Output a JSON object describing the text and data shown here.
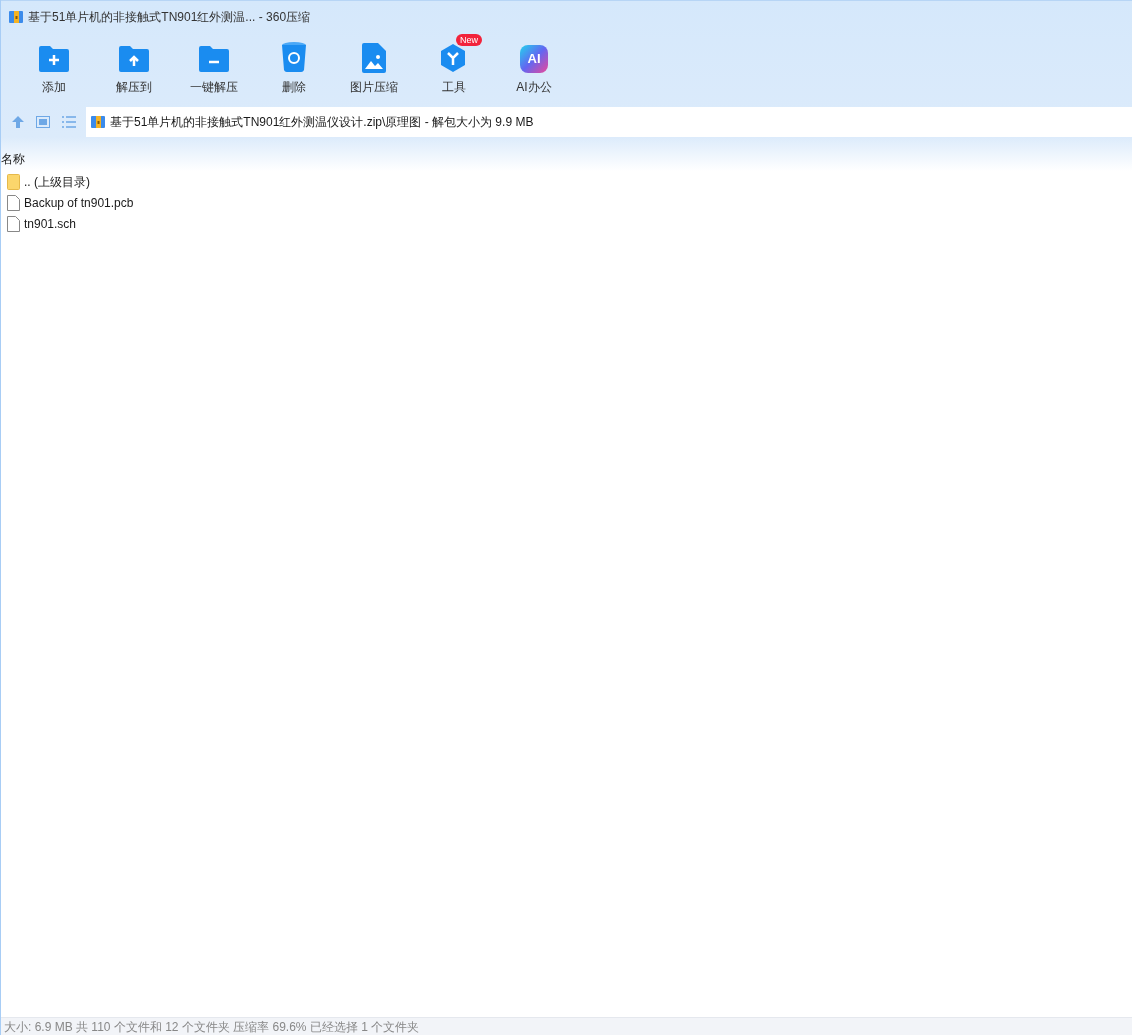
{
  "window": {
    "title": "基于51单片机的非接触式TN901红外测温... - 360压缩"
  },
  "toolbar": [
    {
      "kind": "add",
      "label": "添加"
    },
    {
      "kind": "extract",
      "label": "解压到"
    },
    {
      "kind": "quick",
      "label": "一键解压"
    },
    {
      "kind": "delete",
      "label": "删除"
    },
    {
      "kind": "image",
      "label": "图片压缩"
    },
    {
      "kind": "tools",
      "label": "工具",
      "badge": "New"
    },
    {
      "kind": "ai",
      "label": "AI办公",
      "glyph": "AI"
    }
  ],
  "address": {
    "path": "基于51单片机的非接触式TN901红外测温仪设计.zip\\原理图 - 解包大小为 9.9 MB"
  },
  "table": {
    "columns": [
      "名称"
    ],
    "rows": [
      {
        "kind": "folder",
        "name": ".. (上级目录)"
      },
      {
        "kind": "file",
        "name": "Backup of tn901.pcb"
      },
      {
        "kind": "file",
        "name": "tn901.sch"
      }
    ]
  },
  "status_bar": "大小: 6.9 MB 共 110 个文件和 12 个文件夹 压缩率 69.6% 已经选择 1 个文件夹"
}
